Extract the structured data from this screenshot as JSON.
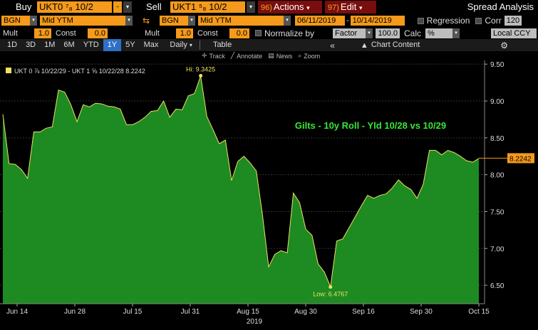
{
  "toolbar1": {
    "buy_label": "Buy",
    "buy_security": "UKT0 ⁷₈ 10/2",
    "sell_label": "Sell",
    "sell_security": "UKT1 ⁵₈ 10/2",
    "actions_num": "96)",
    "actions_label": "Actions",
    "edit_num": "97)",
    "edit_label": "Edit",
    "title": "Spread Analysis"
  },
  "toolbar2": {
    "source_left": "BGN",
    "field_left": "Mid YTM",
    "source_right": "BGN",
    "field_right": "Mid YTM",
    "start_date": "06/11/2019",
    "end_date": "10/14/2019",
    "regression_label": "Regression",
    "corr_label": "Corr",
    "corr_value": "120"
  },
  "toolbar3": {
    "mult_label_left": "Mult",
    "mult_value_left": "1.0",
    "const_label_left": "Const",
    "const_value_left": "0.0",
    "mult_label_right": "Mult",
    "mult_value_right": "1.0",
    "const_label_right": "Const",
    "const_value_right": "0.0",
    "normalize_label": "Normalize by",
    "normalize_value": "Factor",
    "normalize_num": "100.0",
    "calc_label": "Calc",
    "calc_value": "%",
    "ccy_value": "Local CCY"
  },
  "tabs": {
    "periods": [
      "1D",
      "3D",
      "1M",
      "6M",
      "YTD",
      "1Y",
      "5Y",
      "Max"
    ],
    "active": "1Y",
    "frequency": "Daily",
    "table_label": "Table",
    "chart_content_label": "Chart Content"
  },
  "annot_toolbar": {
    "track": "Track",
    "annotate": "Annotate",
    "news": "News",
    "zoom": "Zoom"
  },
  "colors": {
    "fill": "#1e8a22",
    "line": "#f0e060",
    "accent": "#f59a1a",
    "text_green": "#39e639",
    "active_tab": "#2e6fc8"
  },
  "chart_data": {
    "type": "area",
    "title": "Gilts - 10y Roll - Yld  10/28 vs 10/29",
    "legend": "UKT 0 ⅞ 10/22/29 - UKT 1 ⅝ 10/22/28 8.2242",
    "legend_placement": "top-left",
    "ylim": [
      6.25,
      9.55
    ],
    "yticks": [
      6.5,
      7.0,
      7.5,
      8.0,
      8.5,
      9.0,
      9.5
    ],
    "y_tick_labels": [
      "6.50",
      "7.00",
      "7.50",
      "8.00",
      "8.50",
      "9.00",
      "9.50"
    ],
    "x_tick_labels": [
      "Jun 14",
      "Jun 28",
      "Jul 15",
      "Jul 31",
      "Aug 15",
      "Aug 30",
      "Sep 16",
      "Sep 30",
      "Oct 15"
    ],
    "x_year_label": "2019",
    "hi_label": "Hi: 9.3425",
    "hi_value": 9.3425,
    "low_label": "Low: 6.4767",
    "low_value": 6.4767,
    "last_label": "8.2242",
    "last_value": 8.2242,
    "series": [
      {
        "values": [
          8.82,
          8.15,
          8.14,
          8.07,
          7.95,
          8.58,
          8.58,
          8.63,
          8.65,
          9.15,
          9.12,
          8.95,
          8.72,
          8.95,
          8.92,
          8.97,
          8.96,
          8.93,
          8.92,
          8.89,
          8.68,
          8.68,
          8.72,
          8.78,
          8.86,
          8.87,
          9.0,
          8.78,
          8.89,
          8.88,
          9.07,
          9.1,
          9.34,
          8.79,
          8.61,
          8.42,
          8.47,
          7.92,
          8.18,
          8.25,
          8.16,
          8.05,
          7.45,
          6.75,
          6.92,
          6.97,
          6.94,
          7.75,
          7.62,
          7.26,
          7.18,
          6.79,
          6.68,
          6.48,
          7.1,
          7.13,
          7.28,
          7.43,
          7.58,
          7.72,
          7.68,
          7.72,
          7.74,
          7.82,
          7.93,
          7.85,
          7.8,
          7.68,
          7.87,
          8.33,
          8.33,
          8.27,
          8.33,
          8.3,
          8.25,
          8.19,
          8.17,
          8.22
        ]
      }
    ]
  }
}
